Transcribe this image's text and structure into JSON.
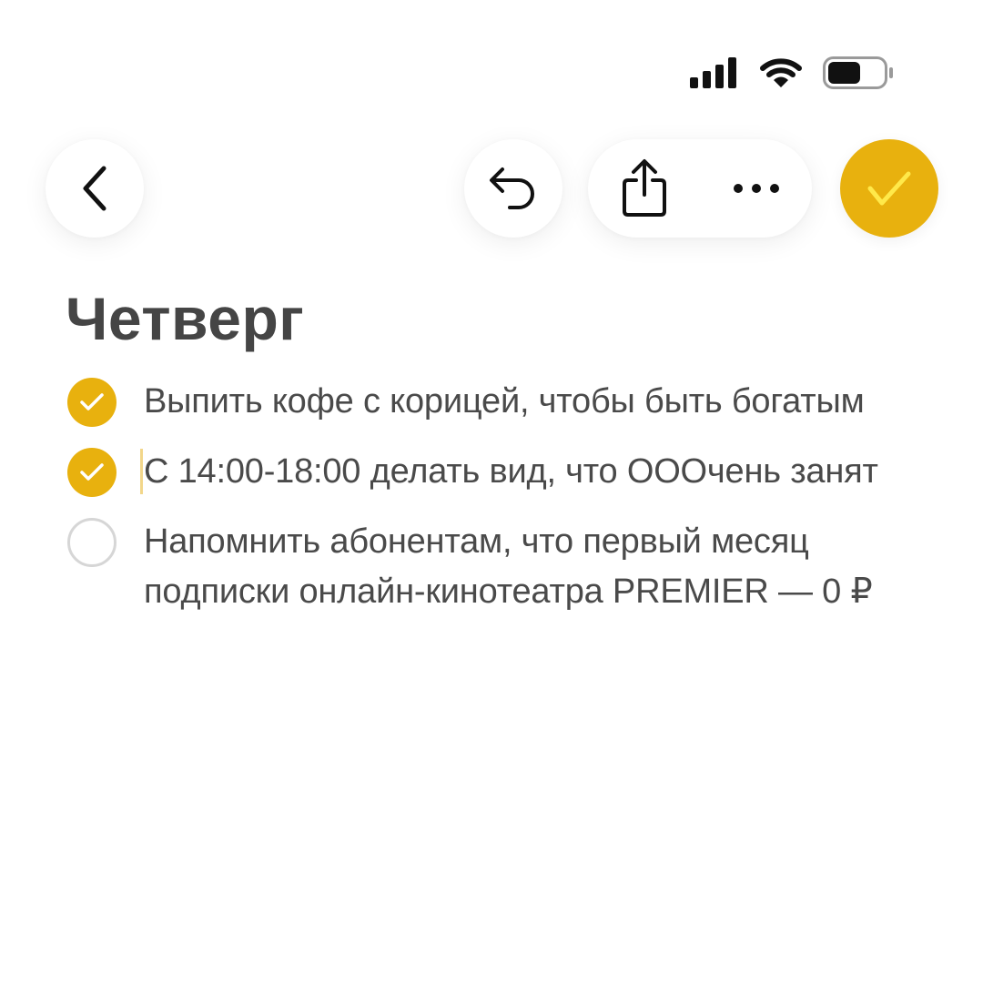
{
  "status_bar": {
    "signal_icon": "cellular-signal-icon",
    "wifi_icon": "wifi-icon",
    "battery_icon": "battery-icon",
    "battery_level": 0.6
  },
  "toolbar": {
    "back_icon": "chevron-left-icon",
    "undo_icon": "undo-icon",
    "share_icon": "share-icon",
    "more_icon": "more-dots-icon",
    "done_icon": "checkmark-icon"
  },
  "note": {
    "title": "Четверг",
    "items": [
      {
        "text": "Выпить кофе с корицей, чтобы быть богатым",
        "checked": true
      },
      {
        "text": "С 14:00-18:00 делать вид, что ОООчень занят",
        "checked": true
      },
      {
        "text": "Напомнить абонентам, что первый месяц подписки онлайн-кинотеатра PREMIER — 0 ₽",
        "checked": false
      }
    ]
  },
  "colors": {
    "accent": "#E8B10E",
    "done_check": "#FFE94A",
    "text": "#454545",
    "unchecked_border": "#D6D6D6"
  }
}
